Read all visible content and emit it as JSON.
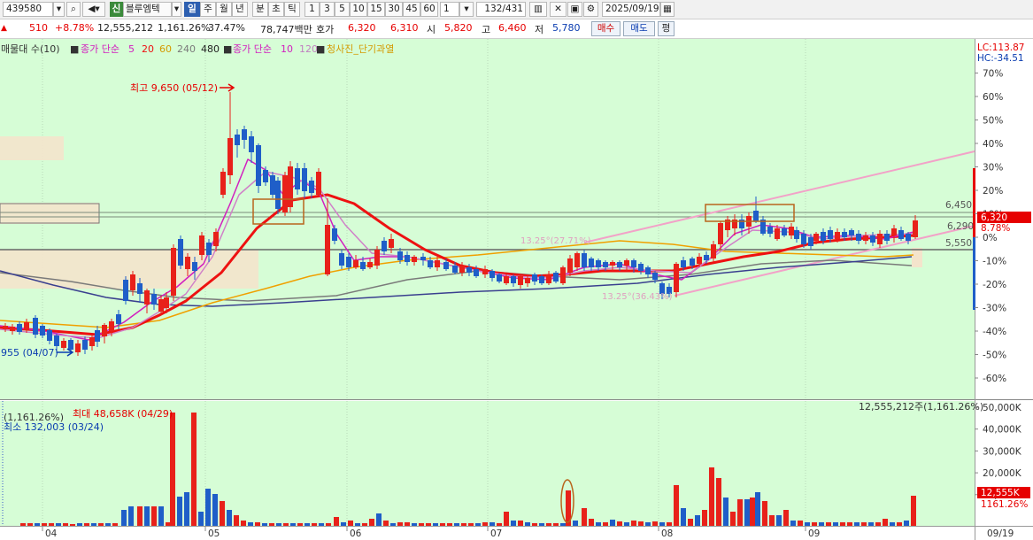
{
  "toolbar": {
    "code": "439580",
    "credit_badge": "신",
    "stock_name": "블루엠텍",
    "period_selected": "일",
    "periods": [
      "주",
      "월",
      "년",
      "분",
      "초",
      "틱"
    ],
    "intervals": [
      "1",
      "3",
      "5",
      "10",
      "15",
      "30",
      "45",
      "60"
    ],
    "count": "1",
    "page_counter": "132",
    "page_total": "/431",
    "date": "2025/09/19"
  },
  "info": {
    "change_arrow": "▲",
    "change": "510",
    "change_pct": "+8.78%",
    "volume": "12,555,212",
    "volume_ratio": "1,161.26%",
    "turnover": "37.47%",
    "amount": "78,747백만",
    "bid_label": "호가",
    "ask_price": "6,320",
    "bid_price": "6,310",
    "open_label": "시",
    "open": "5,820",
    "high_label": "고",
    "high": "6,460",
    "low_label": "저",
    "low": "5,780",
    "buy_label": "매수",
    "sell_label": "매도",
    "avg_label": "평"
  },
  "legend": {
    "vp": "매물대 수(10)",
    "ma_a": "종가 단순",
    "ma_a_periods": [
      "5",
      "20",
      "60",
      "240",
      "480"
    ],
    "ma_b": "종가 단순",
    "ma_b_periods": [
      "10",
      "120"
    ],
    "signal": "청사진_단기과열"
  },
  "colors": {
    "up": "#e8211a",
    "down": "#1f5ec8",
    "bg": "#d6fdd6",
    "ma5": "#d21fbf",
    "ma20": "#ee1111",
    "ma60": "#f0a000",
    "ma120": "#d080c8",
    "ma240": "#7a7a7a",
    "ma480": "#3a3f8f",
    "trend": "#f2a2c8"
  },
  "annotations": {
    "max_price": "최고 9,650 (05/12)",
    "min_price": "955 (04/07)",
    "trend_upper": "13.25°(27.71%)",
    "trend_lower": "13.25°(36.43%)",
    "level_high": "6,450",
    "level_mid": "6,290",
    "level_low": "5,550",
    "lc": "LC:113.87",
    "hc": "HC:-34.51",
    "price_tag": "6,320",
    "pct_tag": "8.78%",
    "vol_ratio_left": "(1,161.26%)",
    "vol_max": "최대 48,658K (04/29)",
    "vol_min": "최소 132,003 (03/24)",
    "vol_right": "12,555,212주(1,161.26%)",
    "vol_tag": "12,555K",
    "vol_pct_tag": "1161.26%"
  },
  "chart_data": {
    "type": "candlestick",
    "price_axis_pct": [
      "70%",
      "60%",
      "50%",
      "40%",
      "30%",
      "20%",
      "10%",
      "0%",
      "-10%",
      "-20%",
      "-30%",
      "-40%",
      "-50%",
      "-60%"
    ],
    "volume_axis": [
      "50,000K",
      "40,000K",
      "30,000K",
      "20,000K",
      "10,000K"
    ],
    "x_ticks": [
      "04",
      "05",
      "06",
      "07",
      "08",
      "09",
      "09/19"
    ]
  }
}
